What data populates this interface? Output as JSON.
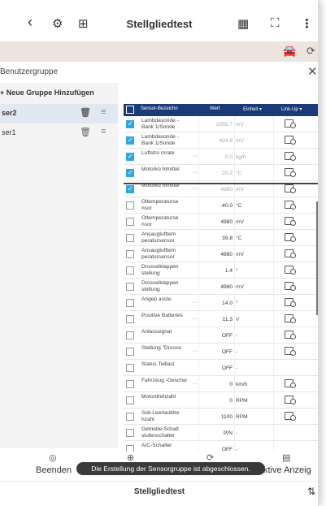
{
  "header": {
    "title": "Stellgliedtest",
    "icons": [
      "back-arrow",
      "gear-search",
      "add-folder",
      "calculator",
      "expand-frame",
      "kebab-menu"
    ]
  },
  "band": {
    "icons": [
      "car-icon",
      "refresh-icon"
    ]
  },
  "dialog": {
    "title": "Benutzergruppe",
    "add_group": "+ Neue Gruppe Hinzufügen",
    "groups": [
      {
        "name": "ser2",
        "selected": true
      },
      {
        "name": "ser1",
        "selected": false
      }
    ]
  },
  "table": {
    "headers": {
      "name": "Sensor-Bezeichn",
      "value": "Wert",
      "unit": "Einheit ▾",
      "link": "Link-Up ▾"
    },
    "rows": [
      {
        "name": "Lambdasonde -Bank 1/Sonde",
        "value": "2055.7",
        "unit": "mV",
        "checked": true,
        "link": true
      },
      {
        "name": "Lambdasonde -Bank 1/Sonde",
        "value": "424.8",
        "unit": "mV",
        "checked": true,
        "link": true
      },
      {
        "name": "Luftstro mrate",
        "value": "0.0",
        "unit": "kg/h",
        "checked": true,
        "link": true,
        "dots": true
      },
      {
        "name": "Motorkü hlmittel",
        "value": "20.2",
        "unit": "°C",
        "checked": true,
        "link": true,
        "dots": true
      },
      {
        "name": "Motorkü hlmittel",
        "value": "4980",
        "unit": "mV",
        "checked": true,
        "link": true,
        "dots": true
      },
      {
        "name": "Öltemperaturse nsor",
        "value": "-40.0",
        "unit": "°C",
        "checked": false,
        "link": true
      },
      {
        "name": "Öltemperaturse nsor",
        "value": "4980",
        "unit": "mV",
        "checked": false,
        "link": true
      },
      {
        "name": "Ansauglufttem peratursensor",
        "value": "39.8",
        "unit": "°C",
        "checked": false,
        "link": true
      },
      {
        "name": "Ansauglufttem peratursensor",
        "value": "4980",
        "unit": "mV",
        "checked": false,
        "link": true
      },
      {
        "name": "Drosselklappen stellung",
        "value": "1.4",
        "unit": "°",
        "checked": false,
        "link": true
      },
      {
        "name": "Drosselklappen stellung",
        "value": "4980",
        "unit": "mV",
        "checked": false,
        "link": true
      },
      {
        "name": "Angep asste",
        "value": "14.0",
        "unit": "°",
        "checked": false,
        "link": true,
        "dots": true
      },
      {
        "name": "Positive Batteries",
        "value": "11.3",
        "unit": "V",
        "checked": false,
        "link": true,
        "dots": true
      },
      {
        "name": "Anlasssignal",
        "value": "OFF",
        "unit": "-",
        "checked": false,
        "link": true
      },
      {
        "name": "Stellung \"Drosse",
        "value": "OFF",
        "unit": "-",
        "checked": false,
        "link": true,
        "dots": true
      },
      {
        "name": "Status Teillast",
        "value": "OFF",
        "unit": "-",
        "checked": false,
        "link": false
      },
      {
        "name": "Fahrzeug -Geschw",
        "value": "0",
        "unit": "km/h",
        "checked": false,
        "link": true,
        "dots": true
      },
      {
        "name": "Motordrehzahl",
        "value": "0",
        "unit": "RPM",
        "checked": false,
        "link": true
      },
      {
        "name": "Soll-Leerlaufdre hzahl",
        "value": "1100",
        "unit": "RPM",
        "checked": false,
        "link": true
      },
      {
        "name": "Getriebe-Schalt stufenschalter",
        "value": "P/N",
        "unit": "-",
        "checked": false,
        "link": false
      },
      {
        "name": "A/C-Schalter",
        "value": "OFF",
        "unit": "-",
        "checked": false,
        "link": false
      }
    ]
  },
  "actions": {
    "end_label": "Beenden",
    "right_label": "ktive Anzeig",
    "toast": "Die Erstellung der Sensorgruppe ist abgeschlossen."
  },
  "footer": {
    "title": "Stellgliedtest"
  }
}
